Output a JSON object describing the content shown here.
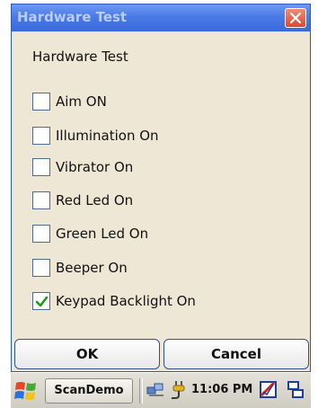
{
  "window": {
    "title": "Hardware Test",
    "heading": "Hardware Test"
  },
  "options": [
    {
      "label": "Aim ON",
      "checked": false
    },
    {
      "label": "Illumination On",
      "checked": false
    },
    {
      "label": "Vibrator On",
      "checked": false
    },
    {
      "label": "Red Led On",
      "checked": false
    },
    {
      "label": "Green Led On",
      "checked": false
    },
    {
      "label": "Beeper On",
      "checked": false
    },
    {
      "label": "Keypad Backlight On",
      "checked": true
    }
  ],
  "buttons": {
    "ok": "OK",
    "cancel": "Cancel"
  },
  "taskbar": {
    "app": "ScanDemo",
    "time": "11:06 PM"
  },
  "icons": {
    "close": "close-icon",
    "check": "checkmark-icon",
    "start": "windows-start-icon",
    "network": "network-icon",
    "power": "power-plug-icon",
    "taskmgr": "task-manager-icon",
    "connection": "connection-icon"
  },
  "colors": {
    "titlebar": "#3a69db",
    "dialog": "#efe7d6",
    "check": "#1f9a1f"
  }
}
